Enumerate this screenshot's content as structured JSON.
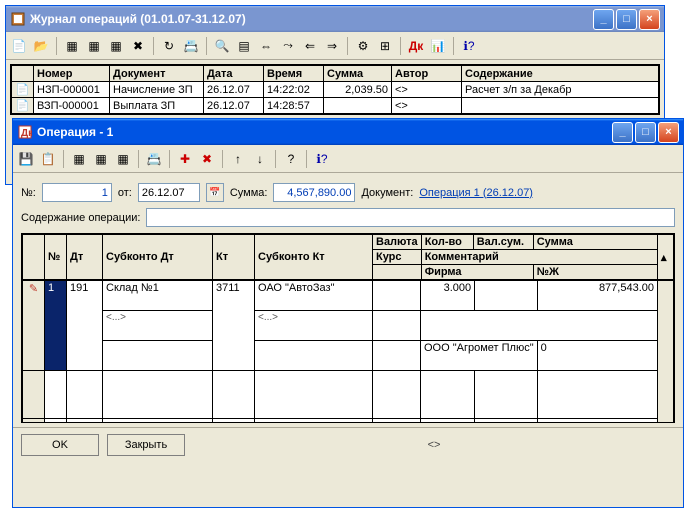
{
  "journal": {
    "title": "Журнал операций (01.01.07-31.12.07)",
    "headers": {
      "номер": "Номер",
      "документ": "Документ",
      "дата": "Дата",
      "время": "Время",
      "сумма": "Сумма",
      "автор": "Автор",
      "содержание": "Содержание"
    },
    "rows": [
      {
        "номер": "НЗП-000001",
        "документ": "Начисление ЗП",
        "дата": "26.12.07",
        "время": "14:22:02",
        "сумма": "2,039.50",
        "автор": "<>",
        "содержание": "Расчет з/п за Декабр"
      },
      {
        "номер": "ВЗП-000001",
        "документ": "Выплата ЗП",
        "дата": "26.12.07",
        "время": "14:28:57",
        "сумма": "",
        "автор": "<>",
        "содержание": ""
      }
    ]
  },
  "operation": {
    "title": "Операция - 1",
    "labels": {
      "номер": "№:",
      "от": "от:",
      "сумма": "Сумма:",
      "документ": "Документ:",
      "содержание": "Содержание операции:",
      "ok": "OK",
      "закрыть": "Закрыть"
    },
    "values": {
      "номер": "1",
      "дата": "26.12.07",
      "сумма": "4,567,890.00",
      "документ_link": "Операция 1 (26.12.07)",
      "содержание": ""
    },
    "grid": {
      "headers": {
        "n": "№",
        "дт": "Дт",
        "субконтодт": "Субконто Дт",
        "кт": "Кт",
        "субконтокт": "Субконто Кт",
        "валюта": "Валюта",
        "колво": "Кол-во",
        "валсум": "Вал.сум.",
        "сумма": "Сумма",
        "курс": "Курс",
        "комментарий": "Комментарий",
        "фирма": "Фирма",
        "нж": "№Ж"
      },
      "rows": [
        {
          "n": "1",
          "дт": "191",
          "субконтодт": "Склад №1",
          "субконтодт2": "<...>",
          "кт": "3711",
          "субконтокт": "ОАО \"АвтоЗаз\"",
          "субконтокт2": "<...>",
          "валюта": "",
          "колво": "3.000",
          "валсум": "",
          "сумма": "877,543.00",
          "фирма": "ООО \"Агромет Плюс\"",
          "нж": "0"
        }
      ]
    },
    "status": "<>"
  }
}
